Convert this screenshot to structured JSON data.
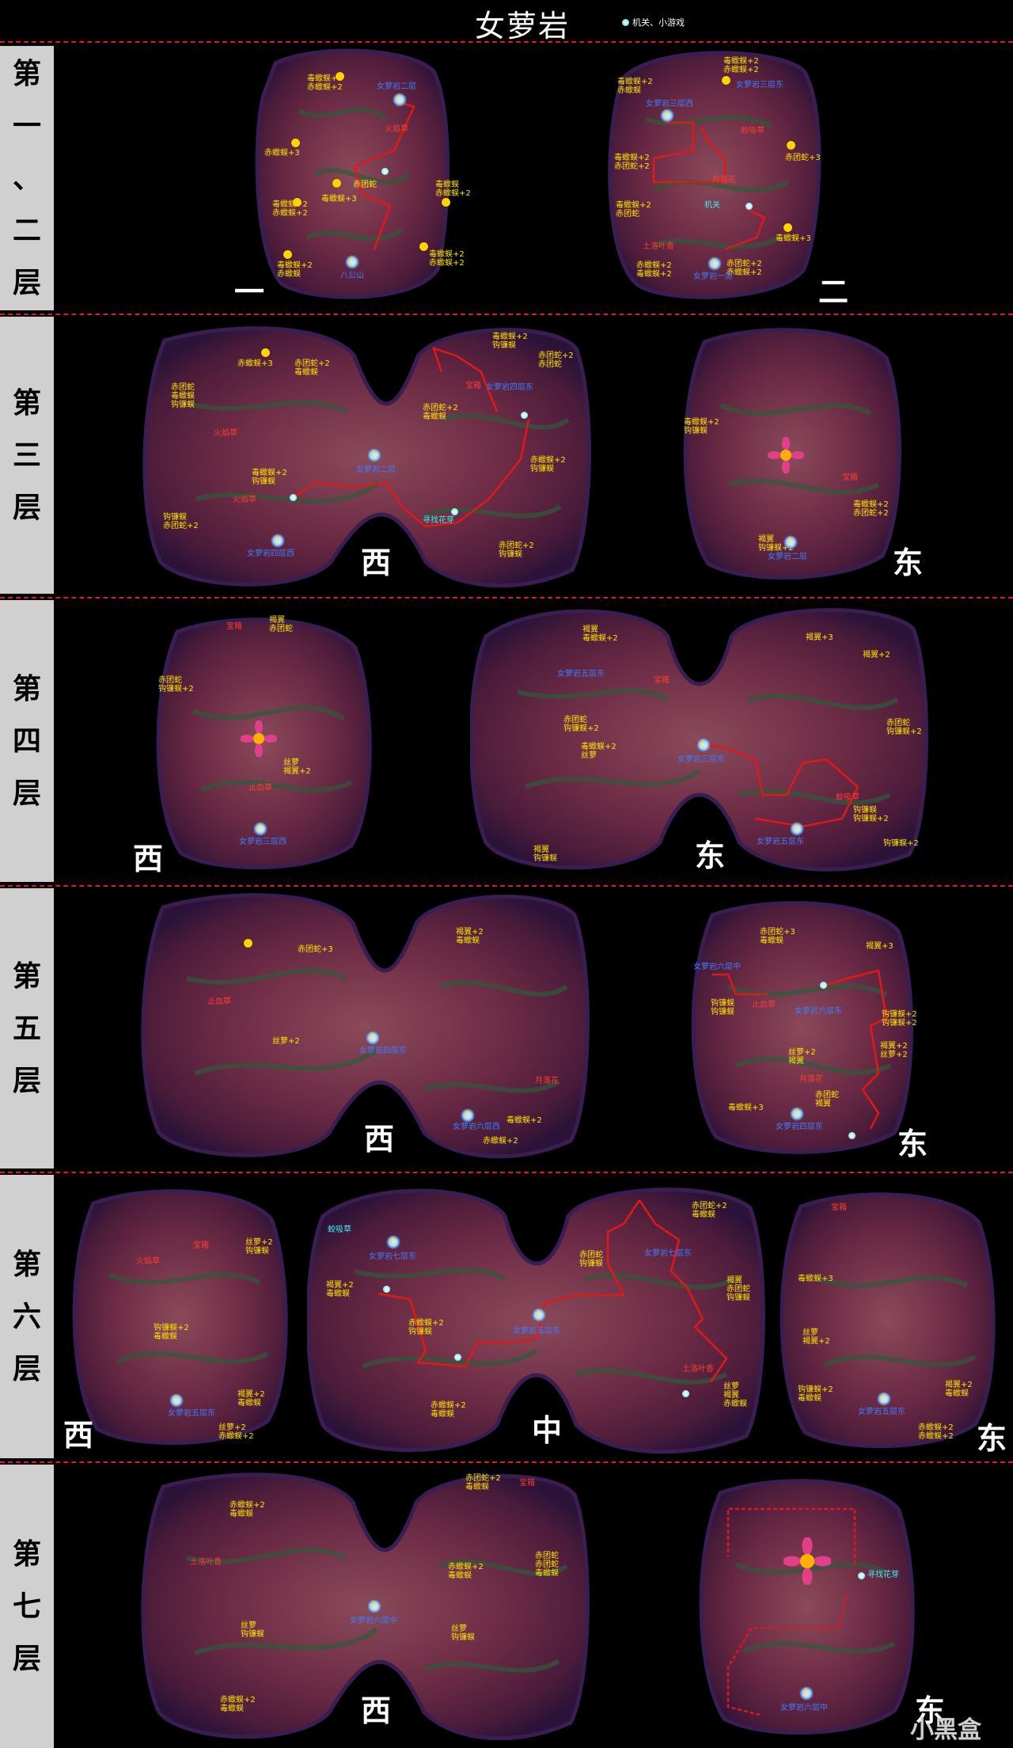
{
  "title": "女萝岩",
  "legend": {
    "icon": "orb-icon",
    "text": "机关、小游戏"
  },
  "floors": [
    {
      "label": [
        "第",
        "一",
        "、",
        "二",
        "层"
      ]
    },
    {
      "label": [
        "第",
        "三",
        "层"
      ]
    },
    {
      "label": [
        "第",
        "四",
        "层"
      ]
    },
    {
      "label": [
        "第",
        "五",
        "层"
      ]
    },
    {
      "label": [
        "第",
        "六",
        "层"
      ]
    },
    {
      "label": [
        "第",
        "七",
        "层"
      ]
    }
  ],
  "regions": {
    "f1": "一",
    "f2": "二",
    "f3w": "西",
    "f3e": "东",
    "f4w": "西",
    "f4e": "东",
    "f5w": "西",
    "f5e": "东",
    "f6w": "西",
    "f6m": "中",
    "f6e": "东",
    "f7w": "西",
    "f7e": "东"
  },
  "labels": {
    "mob_dujiao2": "毒蠍蜈+2",
    "mob_chiyang2": "赤蠍蜈+2",
    "mob_chiyang3": "赤蠍蜈+3",
    "mob_chiyang": "赤蠍蜈",
    "mob_dujiao": "毒蠍蜈",
    "mob_dujiao3": "毒蠍蜈+3",
    "mob_chishe": "赤团蛇",
    "mob_chishe2": "赤团蛇+2",
    "mob_chishe3": "赤团蛇+3",
    "mob_goujiao": "钩镰蜈",
    "mob_goujiao2": "钩镰蜈+2",
    "mob_heji": "褐翼",
    "mob_heji2": "褐翼+2",
    "mob_heji3": "褐翼+3",
    "mob_siluo": "丝萝",
    "mob_siluo2": "丝萝+2",
    "exit_f2": "女萝岩二层",
    "exit_f1": "女萝岩一层",
    "exit_f3e": "女萝岩三层东",
    "exit_f3w": "女萝岩三层西",
    "exit_f4e": "女萝岩四层东",
    "exit_f4w": "女萝岩四层西",
    "exit_f5": "女萝岩五层东",
    "exit_f6w": "女萝岩六层西",
    "exit_f6e": "女萝岩六层东",
    "exit_f6m": "女萝岩六层中",
    "exit_f7": "女萝岩七层东",
    "exit_bagong": "八公山",
    "npc_huoyan": "火焰草",
    "npc_jiaoxi": "蛟吸草",
    "npc_yueguang": "月落花",
    "npc_tulou": "土洛叶香",
    "npc_zhixue": "止血草",
    "npc_xunzhao": "寻找花芽",
    "npc_box": "宝箱",
    "mech_switch": "机关"
  },
  "watermark": "小黑盒"
}
